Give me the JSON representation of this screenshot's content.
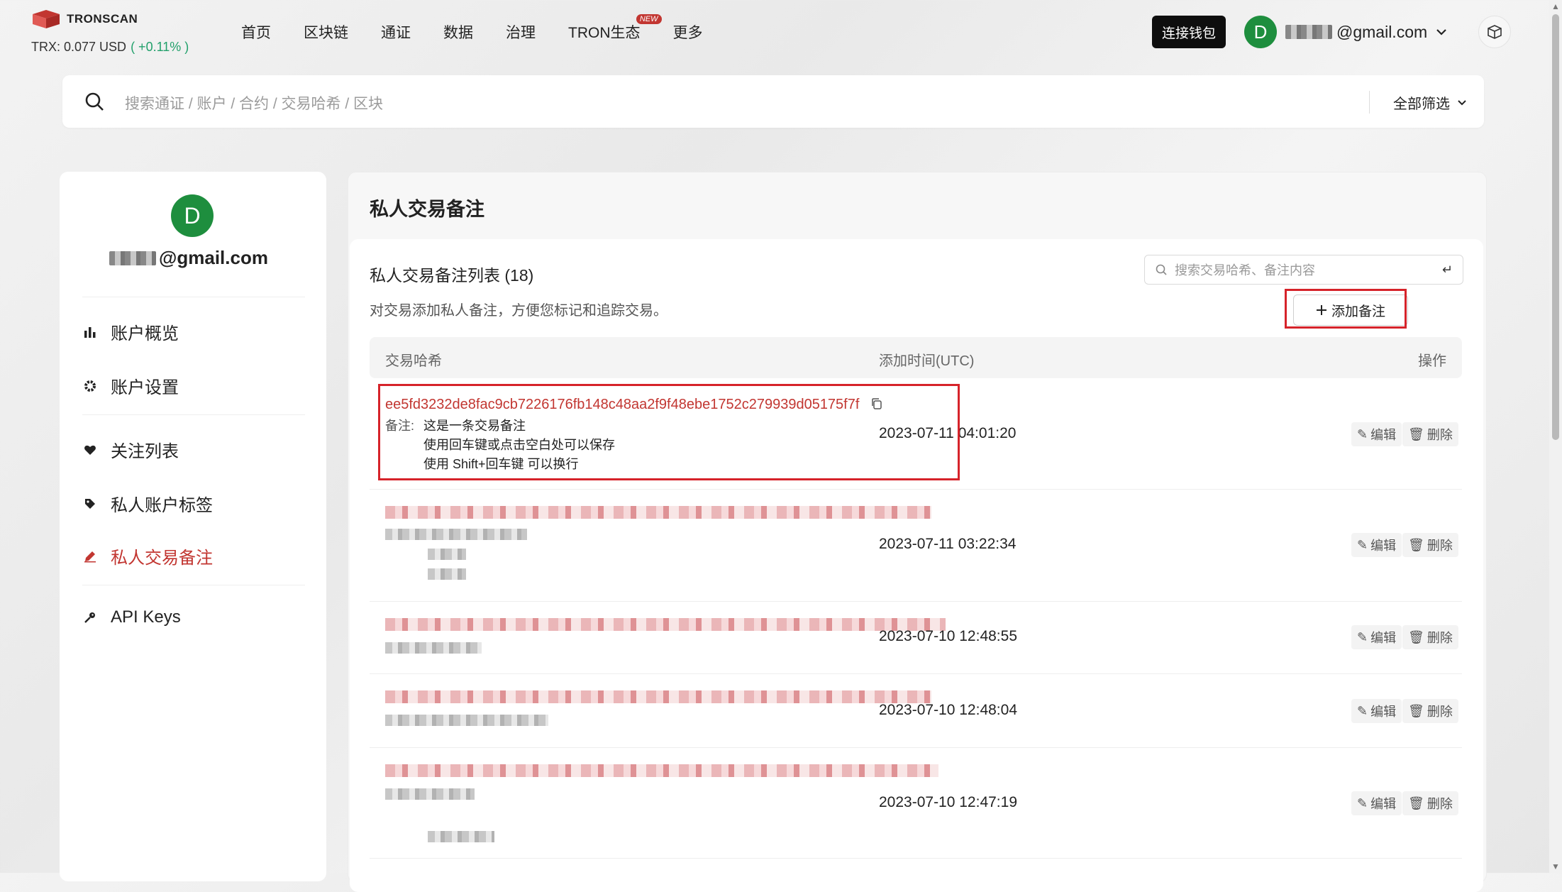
{
  "brand": {
    "name": "TRONSCAN"
  },
  "price": {
    "label": "TRX: 0.077 USD",
    "change": "( +0.11% )"
  },
  "nav": {
    "items": [
      {
        "label": "首页"
      },
      {
        "label": "区块链"
      },
      {
        "label": "通证"
      },
      {
        "label": "数据"
      },
      {
        "label": "治理"
      },
      {
        "label": "TRON生态",
        "badge": "NEW"
      },
      {
        "label": "更多"
      }
    ]
  },
  "header": {
    "connect_wallet": "连接钱包",
    "avatar_letter": "D",
    "email_suffix": "@gmail.com"
  },
  "search": {
    "placeholder": "搜索通证 / 账户 / 合约 / 交易哈希 / 区块",
    "filter_label": "全部筛选"
  },
  "sidebar": {
    "avatar_letter": "D",
    "email_suffix": "@gmail.com",
    "items": [
      {
        "label": "账户概览",
        "icon": "bar-chart-icon"
      },
      {
        "label": "账户设置",
        "icon": "gear-icon"
      },
      {
        "label": "关注列表",
        "icon": "heart-icon"
      },
      {
        "label": "私人账户标签",
        "icon": "tag-icon"
      },
      {
        "label": "私人交易备注",
        "icon": "pencil-icon",
        "active": true
      },
      {
        "label": "API Keys",
        "icon": "key-icon"
      }
    ]
  },
  "main": {
    "title": "私人交易备注",
    "list_title": "私人交易备注列表 (18)",
    "description": "对交易添加私人备注，方便您标记和追踪交易。",
    "search_placeholder": "搜索交易哈希、备注内容",
    "add_button": "添加备注",
    "columns": {
      "hash": "交易哈希",
      "time": "添加时间(UTC)",
      "ops": "操作"
    },
    "edit_label": "编辑",
    "delete_label": "删除",
    "rows": [
      {
        "hash": "ee5fd3232de8fac9cb7226176fb148c48aa2f9f48ebe1752c279939d05175f7f",
        "note_label": "备注:",
        "note_lines": [
          "这是一条交易备注",
          "使用回车键或点击空白处可以保存",
          "使用 Shift+回车键 可以换行"
        ],
        "time": "2023-07-11 04:01:20"
      },
      {
        "time": "2023-07-11 03:22:34"
      },
      {
        "time": "2023-07-10 12:48:55"
      },
      {
        "time": "2023-07-10 12:48:04"
      },
      {
        "time": "2023-07-10 12:47:19"
      }
    ]
  }
}
